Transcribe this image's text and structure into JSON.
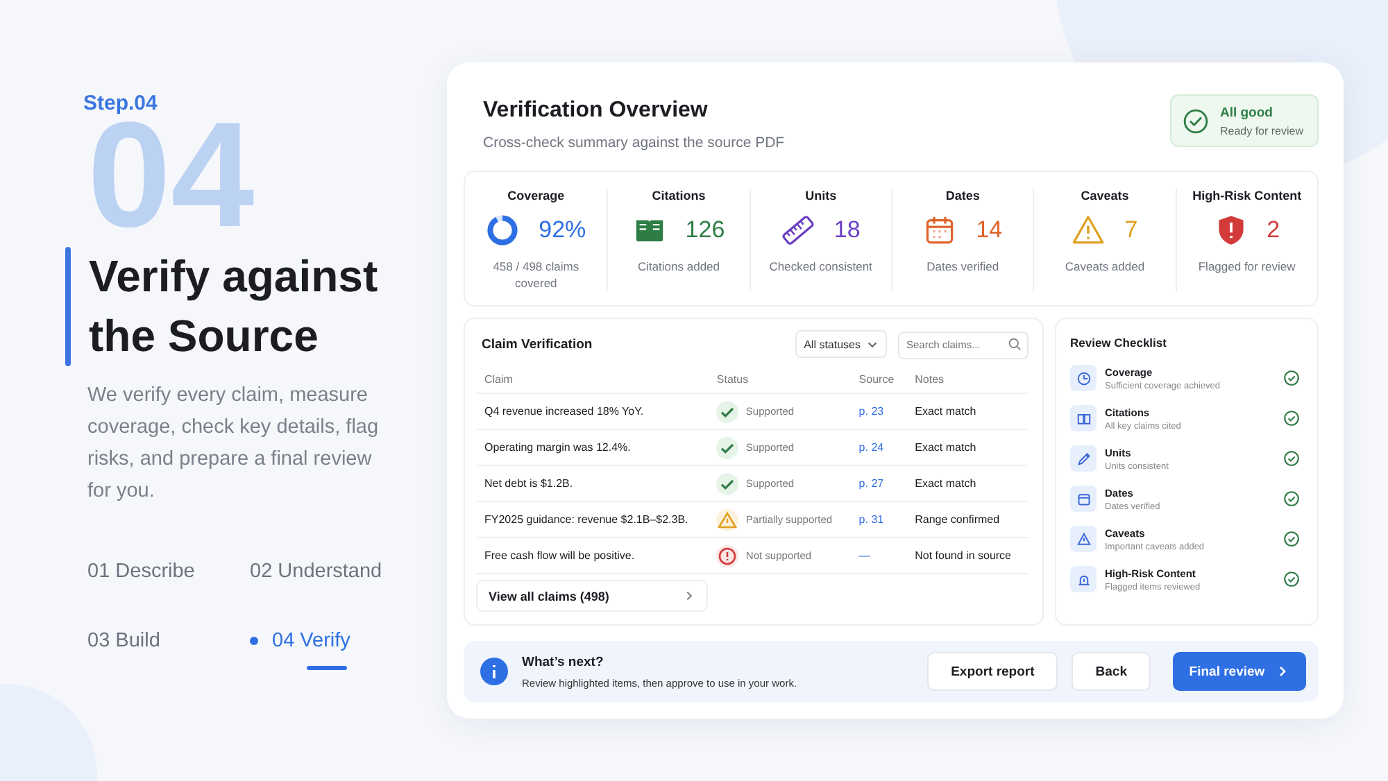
{
  "intro": {
    "step_label": "Step.04",
    "watermark": "04",
    "title": "Verify against the Source",
    "description": "We verify every claim, measure coverage, check key details, flag risks, and prepare a final review for you."
  },
  "steps": [
    {
      "label": "01 Describe",
      "selected": false
    },
    {
      "label": "02 Understand",
      "selected": false
    },
    {
      "label": "03 Build",
      "selected": false
    },
    {
      "label": "04 Verify",
      "selected": true
    }
  ],
  "overview": {
    "title": "Verification Overview",
    "subtitle": "Cross-check summary against the source PDF",
    "badge": {
      "title": "All good",
      "subtitle": "Ready for review"
    }
  },
  "metrics": [
    {
      "kind": "donut",
      "title": "Coverage",
      "value": "92%",
      "caption": "458 / 498 claims covered",
      "color": "#2f6fe4",
      "level": 0.92
    },
    {
      "kind": "book",
      "title": "Citations",
      "value": "126",
      "caption": "Citations added",
      "color": "#2e7d45"
    },
    {
      "kind": "ruler",
      "title": "Units",
      "value": "18",
      "caption": "Checked consistent",
      "color": "#6a3fc4"
    },
    {
      "kind": "calendar",
      "title": "Dates",
      "value": "14",
      "caption": "Dates verified",
      "color": "#e0622a"
    },
    {
      "kind": "warning",
      "title": "Caveats",
      "value": "7",
      "caption": "Caveats added",
      "color": "#e0a020"
    },
    {
      "kind": "shield",
      "title": "High-Risk Content",
      "value": "2",
      "caption": "Flagged for review",
      "color": "#d33a3a"
    }
  ],
  "claims": {
    "title": "Claim Verification",
    "filter": "All statuses",
    "search": {
      "placeholder": "Search claims..."
    },
    "columns": [
      "Claim",
      "Status",
      "Source",
      "Notes"
    ],
    "rows": [
      {
        "claim": "Q4 revenue increased 18% YoY.",
        "kind": "supported",
        "status": "Supported",
        "source": "p. 23",
        "notes": "Exact match"
      },
      {
        "claim": "Operating margin was 12.4%.",
        "kind": "supported",
        "status": "Supported",
        "source": "p. 24",
        "notes": "Exact match"
      },
      {
        "claim": "Net debt is $1.2B.",
        "kind": "supported",
        "status": "Supported",
        "source": "p. 27",
        "notes": "Exact match"
      },
      {
        "claim": "FY2025 guidance: revenue $2.1B–$2.3B.",
        "kind": "partial",
        "status": "Partially supported",
        "source": "p. 31",
        "notes": "Range confirmed"
      },
      {
        "claim": "Free cash flow will be positive.",
        "kind": "unsupported",
        "status": "Not supported",
        "source": "—",
        "notes": "Not found in source"
      }
    ],
    "view_all": "View all claims (498)"
  },
  "checklist": {
    "title": "Review Checklist",
    "items": [
      {
        "kind": "pie",
        "title": "Coverage",
        "subtitle": "Sufficient coverage achieved",
        "checked": true
      },
      {
        "kind": "book",
        "title": "Citations",
        "subtitle": "All key claims cited",
        "checked": true
      },
      {
        "kind": "pencil",
        "title": "Units",
        "subtitle": "Units consistent",
        "checked": true
      },
      {
        "kind": "calendar",
        "title": "Dates",
        "subtitle": "Dates verified",
        "checked": true
      },
      {
        "kind": "warning",
        "title": "Caveats",
        "subtitle": "Important caveats added",
        "checked": true
      },
      {
        "kind": "alarm",
        "title": "High-Risk Content",
        "subtitle": "Flagged items reviewed",
        "checked": true
      }
    ]
  },
  "footer": {
    "title": "What’s next?",
    "text": "Review highlighted items, then approve to use in your work.",
    "buttons": [
      {
        "label": "Export report",
        "kind": "secondary"
      },
      {
        "label": "Back",
        "kind": "secondary"
      },
      {
        "label": "Final review",
        "kind": "primary"
      }
    ]
  }
}
